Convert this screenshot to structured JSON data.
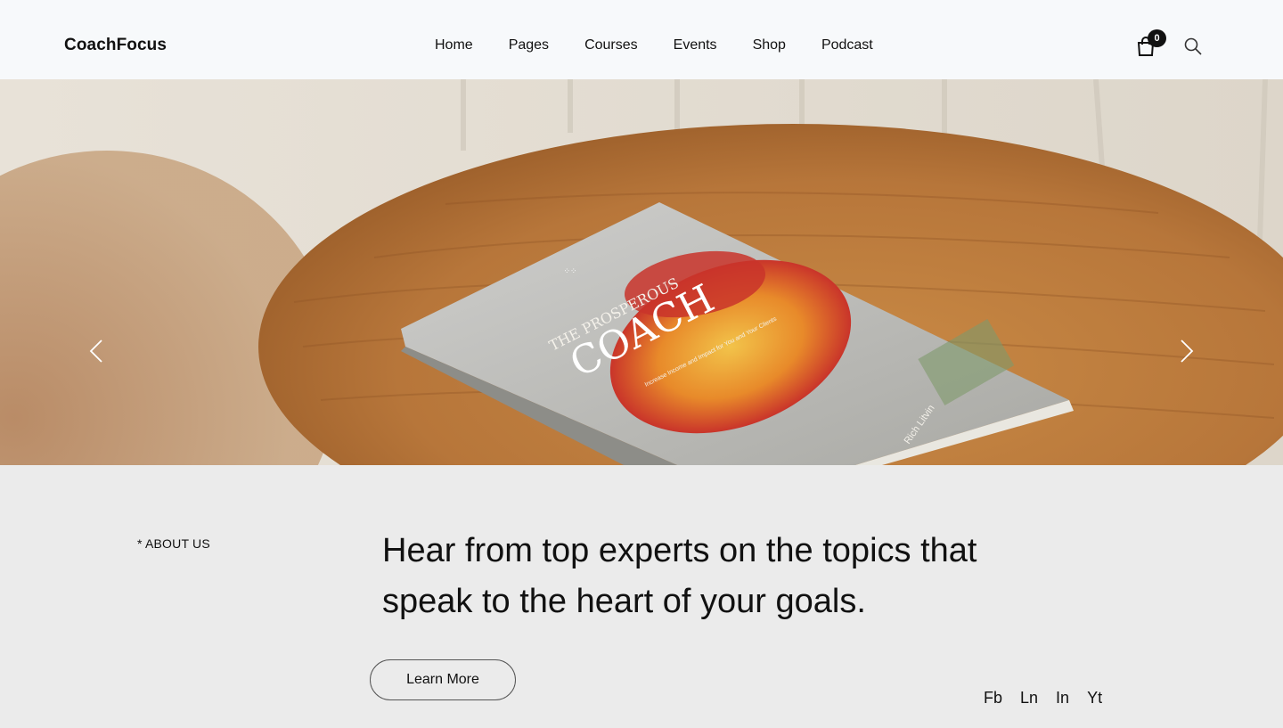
{
  "header": {
    "logo": "CoachFocus",
    "nav": [
      "Home",
      "Pages",
      "Courses",
      "Events",
      "Shop",
      "Podcast"
    ],
    "cart_count": "0"
  },
  "hero": {
    "book": {
      "title_top": "THE PROSPEROUS",
      "title_main": "COACH",
      "subtitle": "Increase Income and Impact for You and Your Clients",
      "author": "Rich Litvin"
    }
  },
  "about": {
    "label": "* ABOUT US",
    "headline_line1": "Hear from top experts on the topics that",
    "headline_line2": "speak to the heart of your goals.",
    "button": "Learn More"
  },
  "social": [
    "Fb",
    "Ln",
    "In",
    "Yt"
  ],
  "colors": {
    "header_bg": "#f7f9fb",
    "section_bg": "#ebebeb",
    "text": "#111111"
  },
  "icons": [
    "shopping-bag-icon",
    "search-icon",
    "chevron-left-icon",
    "chevron-right-icon"
  ]
}
